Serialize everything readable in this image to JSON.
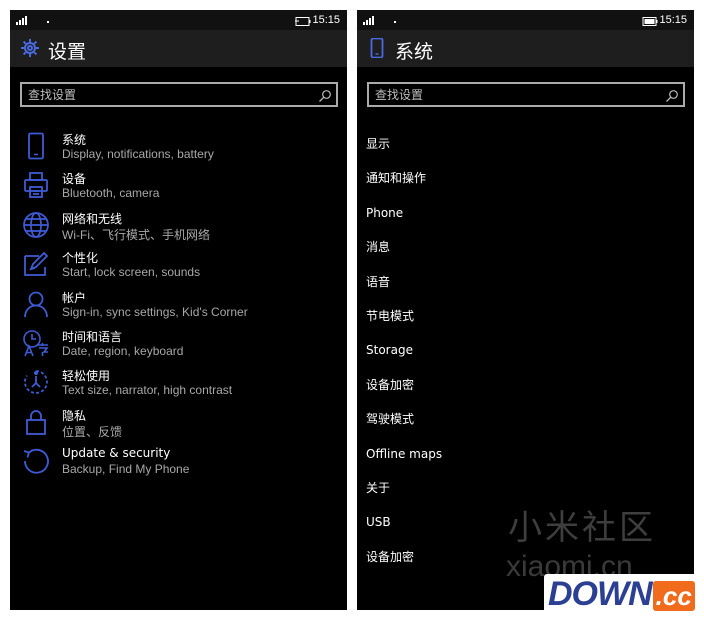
{
  "status_bar": {
    "time": "15:15"
  },
  "left_screen": {
    "title": "设置",
    "search_placeholder": "查找设置",
    "categories": [
      {
        "icon": "phone-icon",
        "title": "系统",
        "subtitle": "Display, notifications, battery"
      },
      {
        "icon": "printer-icon",
        "title": "设备",
        "subtitle": "Bluetooth, camera"
      },
      {
        "icon": "globe-icon",
        "title": "网络和无线",
        "subtitle": "Wi-Fi、飞行模式、手机网络"
      },
      {
        "icon": "paint-icon",
        "title": "个性化",
        "subtitle": "Start, lock screen, sounds"
      },
      {
        "icon": "person-icon",
        "title": "帐户",
        "subtitle": "Sign-in, sync settings, Kid's Corner"
      },
      {
        "icon": "time-language-icon",
        "title": "时间和语言",
        "subtitle": "Date, region, keyboard"
      },
      {
        "icon": "ease-of-access-icon",
        "title": "轻松使用",
        "subtitle": "Text size, narrator, high contrast"
      },
      {
        "icon": "lock-icon",
        "title": "隐私",
        "subtitle": "位置、反馈"
      },
      {
        "icon": "update-icon",
        "title": "Update & security",
        "subtitle": "Backup, Find My Phone"
      }
    ]
  },
  "right_screen": {
    "title": "系统",
    "search_placeholder": "查找设置",
    "items": [
      "显示",
      "通知和操作",
      "Phone",
      "消息",
      "语音",
      "节电模式",
      "Storage",
      "设备加密",
      "驾驶模式",
      "Offline maps",
      "关于",
      "USB",
      "设备加密"
    ]
  },
  "watermarks": {
    "xiaomi_cn": "小米社区",
    "xiaomi_url": "xiaomi.cn",
    "down_text": "DOWN",
    "down_suffix": ".cc"
  },
  "colors": {
    "accent": "#3e5bd6",
    "background": "#000000",
    "title_bar": "#1e1e1e",
    "subtitle": "#a8a8a8"
  }
}
